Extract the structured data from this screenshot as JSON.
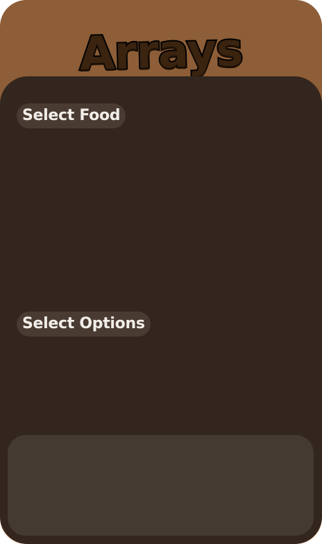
{
  "header": {
    "title": "Arrays"
  },
  "sections": {
    "food_label": "Select Food",
    "options_label": "Select Options"
  },
  "colors": {
    "frame": "#8d5e37",
    "panel": "#33261e",
    "label_bg": "#4a3b32",
    "result_bg": "#453a32",
    "text": "#f2eeea"
  }
}
